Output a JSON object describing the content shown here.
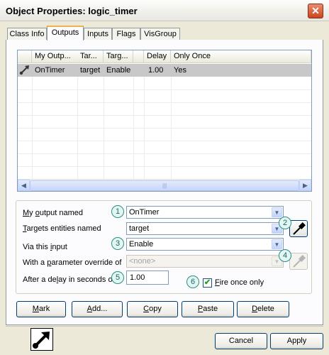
{
  "window": {
    "title": "Object Properties: logic_timer",
    "close_symbol": "✕"
  },
  "tabs": [
    {
      "label": "Class Info",
      "active": false
    },
    {
      "label": "Outputs",
      "active": true
    },
    {
      "label": "Inputs",
      "active": false
    },
    {
      "label": "Flags",
      "active": false
    },
    {
      "label": "VisGroup",
      "active": false
    }
  ],
  "outputs_list": {
    "columns": [
      "My Outp...",
      "Tar...",
      "Targ...",
      "Delay",
      "Only Once"
    ],
    "rows": [
      {
        "icon": "output-arrow-icon",
        "my_output": "OnTimer",
        "target": "target",
        "target_input": "Enable",
        "delay": "1.00",
        "only_once": "Yes"
      }
    ],
    "scroll_left": "◀",
    "scroll_right": "▶",
    "grip": "|||"
  },
  "form": {
    "output_label": "My output named",
    "output_value": "OnTimer",
    "targets_label": "Targets entities named",
    "targets_value": "target",
    "input_label": "Via this input",
    "input_value": "Enable",
    "param_label": "With a parameter override of",
    "param_value": "<none>",
    "delay_label": "After a delay in seconds of",
    "delay_value": "1.00",
    "fire_once_label": "Fire once only",
    "fire_once_checked": true,
    "check_mark": "✔",
    "dropdown_arrow": "▼"
  },
  "badges": [
    "1",
    "2",
    "3",
    "4",
    "5",
    "6"
  ],
  "action_buttons": {
    "mark": "Mark",
    "add": "Add...",
    "copy": "Copy",
    "paste": "Paste",
    "delete": "Delete"
  },
  "footer": {
    "cancel": "Cancel",
    "apply": "Apply"
  },
  "colors": {
    "selected_row": "#c8c8c8",
    "badge_teal": "#2d8c86",
    "close_red": "#c8461f"
  }
}
